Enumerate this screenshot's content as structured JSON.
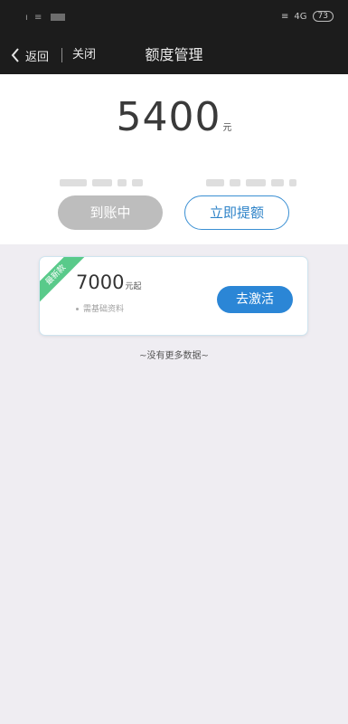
{
  "status_bar": {
    "network": "4G",
    "battery": "73"
  },
  "nav": {
    "back_label": "返回",
    "close_label": "关闭",
    "title": "额度管理"
  },
  "quota": {
    "amount": "5400",
    "unit": "元",
    "pending_button": "到账中",
    "withdraw_button": "立即提额"
  },
  "product_card": {
    "ribbon": "最新款",
    "amount": "7000",
    "amount_suffix": "元起",
    "note": "需基础资料",
    "action_button": "去激活",
    "accent_color": "#2b86d6",
    "ribbon_color": "#48c57e"
  },
  "footer": {
    "no_more": "~没有更多数据~"
  }
}
